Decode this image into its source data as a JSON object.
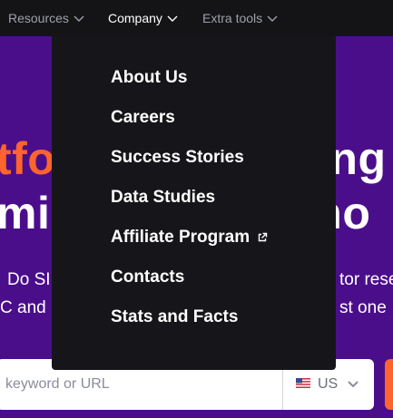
{
  "nav": {
    "items": [
      {
        "label": "Resources"
      },
      {
        "label": "Company"
      },
      {
        "label": "Extra tools"
      }
    ]
  },
  "dropdown": {
    "items": [
      {
        "label": "About Us"
      },
      {
        "label": "Careers"
      },
      {
        "label": "Success Stories"
      },
      {
        "label": "Data Studies"
      },
      {
        "label": "Affiliate Program",
        "icon": "external-link-icon"
      },
      {
        "label": "Contacts"
      },
      {
        "label": "Stats and Facts"
      }
    ]
  },
  "hero": {
    "line1_left": "tfo",
    "line1_right": "ning",
    "line2_left": "mi",
    "line2_right": "cho",
    "sub1_left": "Do SI",
    "sub1_right": "tor rese",
    "sub2_left": "C and",
    "sub2_right": "st one"
  },
  "search": {
    "placeholder": "keyword or URL",
    "region": "US",
    "region_flag": "us-flag-icon"
  },
  "colors": {
    "nav_bg": "#141417",
    "dropdown_bg": "#16161a",
    "hero_bg": "#4b0e8b",
    "accent_orange": "#ff642d",
    "nav_text": "#9da1ab"
  }
}
